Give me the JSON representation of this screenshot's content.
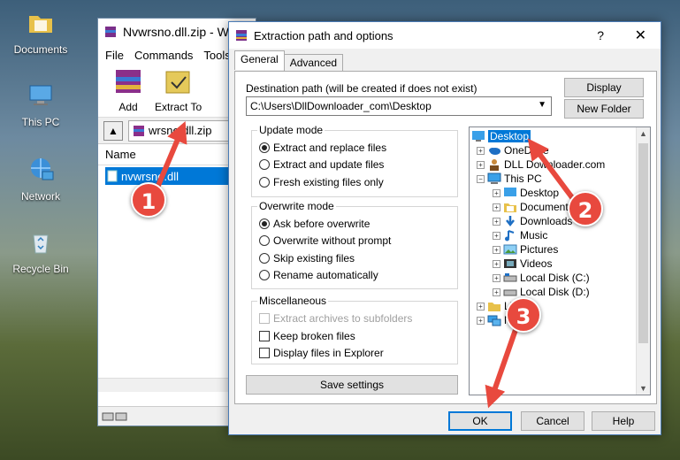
{
  "desktop": {
    "icons": [
      {
        "label": "Documents",
        "icon": "folder-icon"
      },
      {
        "label": "This PC",
        "icon": "computer-icon"
      },
      {
        "label": "Network",
        "icon": "network-icon"
      },
      {
        "label": "Recycle Bin",
        "icon": "recycle-bin-icon"
      }
    ]
  },
  "winrar": {
    "title": "Nvwrsno.dll.zip - Wi",
    "menu": [
      "File",
      "Commands",
      "Tools"
    ],
    "tools": [
      {
        "label": "Add",
        "icon": "add-archive-icon"
      },
      {
        "label": "Extract To",
        "icon": "extract-to-icon"
      }
    ],
    "path": "wrsno.dll.zip",
    "column_name": "Name",
    "file": "nvwrsno.dll"
  },
  "dialog": {
    "title": "Extraction path and options",
    "help": "?",
    "close": "✕",
    "tabs": [
      "General",
      "Advanced"
    ],
    "dest_label": "Destination path (will be created if does not exist)",
    "dest_value": "C:\\Users\\DllDownloader_com\\Desktop",
    "display_button": "Display",
    "new_folder_button": "New Folder",
    "update_mode": {
      "title": "Update mode",
      "options": [
        "Extract and replace files",
        "Extract and update files",
        "Fresh existing files only"
      ],
      "selected": 0
    },
    "overwrite_mode": {
      "title": "Overwrite mode",
      "options": [
        "Ask before overwrite",
        "Overwrite without prompt",
        "Skip existing files",
        "Rename automatically"
      ],
      "selected": 0
    },
    "misc": {
      "title": "Miscellaneous",
      "options": [
        {
          "label": "Extract archives to subfolders",
          "checked": false,
          "disabled": true
        },
        {
          "label": "Keep broken files",
          "checked": false,
          "disabled": false
        },
        {
          "label": "Display files in Explorer",
          "checked": false,
          "disabled": false
        }
      ]
    },
    "save_settings": "Save settings",
    "tree": [
      {
        "label": "Desktop",
        "icon": "desktop-icon",
        "selected": true
      },
      {
        "label": "OneDrive",
        "icon": "onedrive-icon"
      },
      {
        "label": "DLL Downloader.com",
        "icon": "user-icon"
      },
      {
        "label": "This PC",
        "icon": "computer-icon"
      },
      {
        "label": "Desktop",
        "icon": "desktop-icon"
      },
      {
        "label": "Documents",
        "icon": "documents-icon"
      },
      {
        "label": "Downloads",
        "icon": "downloads-icon"
      },
      {
        "label": "Music",
        "icon": "music-icon"
      },
      {
        "label": "Pictures",
        "icon": "pictures-icon"
      },
      {
        "label": "Videos",
        "icon": "videos-icon"
      },
      {
        "label": "Local Disk (C:)",
        "icon": "disk-icon"
      },
      {
        "label": "Local Disk (D:)",
        "icon": "disk-icon"
      },
      {
        "label": "Lil",
        "icon": "libraries-icon"
      },
      {
        "label": "N",
        "icon": "network-icon"
      }
    ],
    "ok": "OK",
    "cancel": "Cancel",
    "help_button": "Help"
  },
  "annotations": [
    "1",
    "2",
    "3"
  ],
  "colors": {
    "badge": "#e8493e",
    "selection": "#0078d7"
  }
}
